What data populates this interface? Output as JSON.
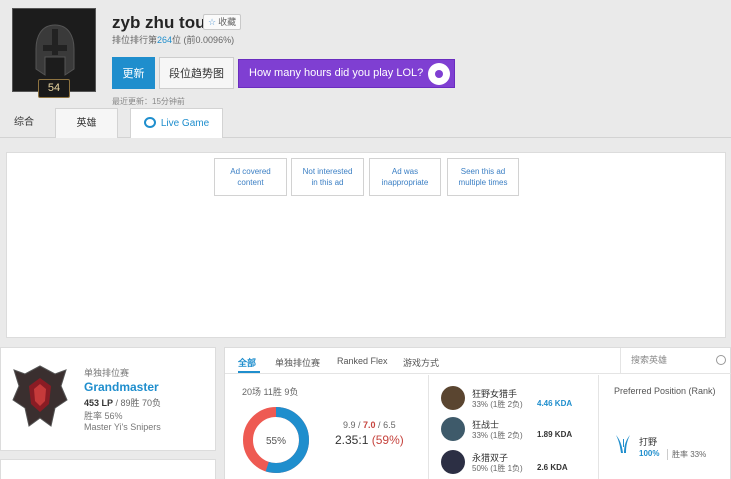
{
  "profile": {
    "name": "zyb zhu tou",
    "favorite_label": "收藏",
    "rank_prefix": "排位排行第",
    "rank_number": "264",
    "rank_suffix": "位 (前0.0096%)",
    "level": "54",
    "update_label": "更新",
    "tier_graph_label": "段位趋势图",
    "last_update": "最近更新：15分钟前"
  },
  "ad_banner": {
    "text": "How many hours did you play LOL?"
  },
  "tabs": {
    "summary": "综合",
    "champions": "英雄",
    "live_game": "Live Game"
  },
  "ad_feedback": {
    "covered": [
      "Ad covered",
      "content"
    ],
    "not_interested": [
      "Not interested",
      "in this ad"
    ],
    "inappropriate": [
      "Ad was",
      "inappropriate"
    ],
    "multiple": [
      "Seen this ad",
      "multiple times"
    ]
  },
  "ranked": {
    "queue": "单独排位赛",
    "tier": "Grandmaster",
    "lp": "453 LP",
    "record": " / 89胜 70负",
    "winrate": "胜率 56%",
    "league": "Master Yi's Snipers"
  },
  "stat_tabs": [
    "全部",
    "单独排位赛",
    "Ranked Flex",
    "游戏方式"
  ],
  "search_placeholder": "搜索英雄",
  "summary": {
    "games": "20场 11胜 9负",
    "win_pct": 55,
    "win_label": "55%",
    "kills": "9.9",
    "deaths": "7.0",
    "assists": "6.5",
    "ratio": "2.35:1",
    "ratio_pct": "(59%)",
    "colors": {
      "win": "#1f8ecd",
      "loss": "#ee5a52"
    }
  },
  "champions": [
    {
      "name": "狂野女猎手",
      "wl": "33% (1胜 2负)",
      "kda": "4.46 KDA"
    },
    {
      "name": "狂战士",
      "wl": "33% (1胜 2负)",
      "kda": "1.89 KDA"
    },
    {
      "name": "永猎双子",
      "wl": "50% (1胜 1负)",
      "kda": "2.6 KDA"
    }
  ],
  "position": {
    "title": "Preferred Position (Rank)",
    "name": "打野",
    "pct": "100%",
    "winrate": "胜率 33%"
  }
}
